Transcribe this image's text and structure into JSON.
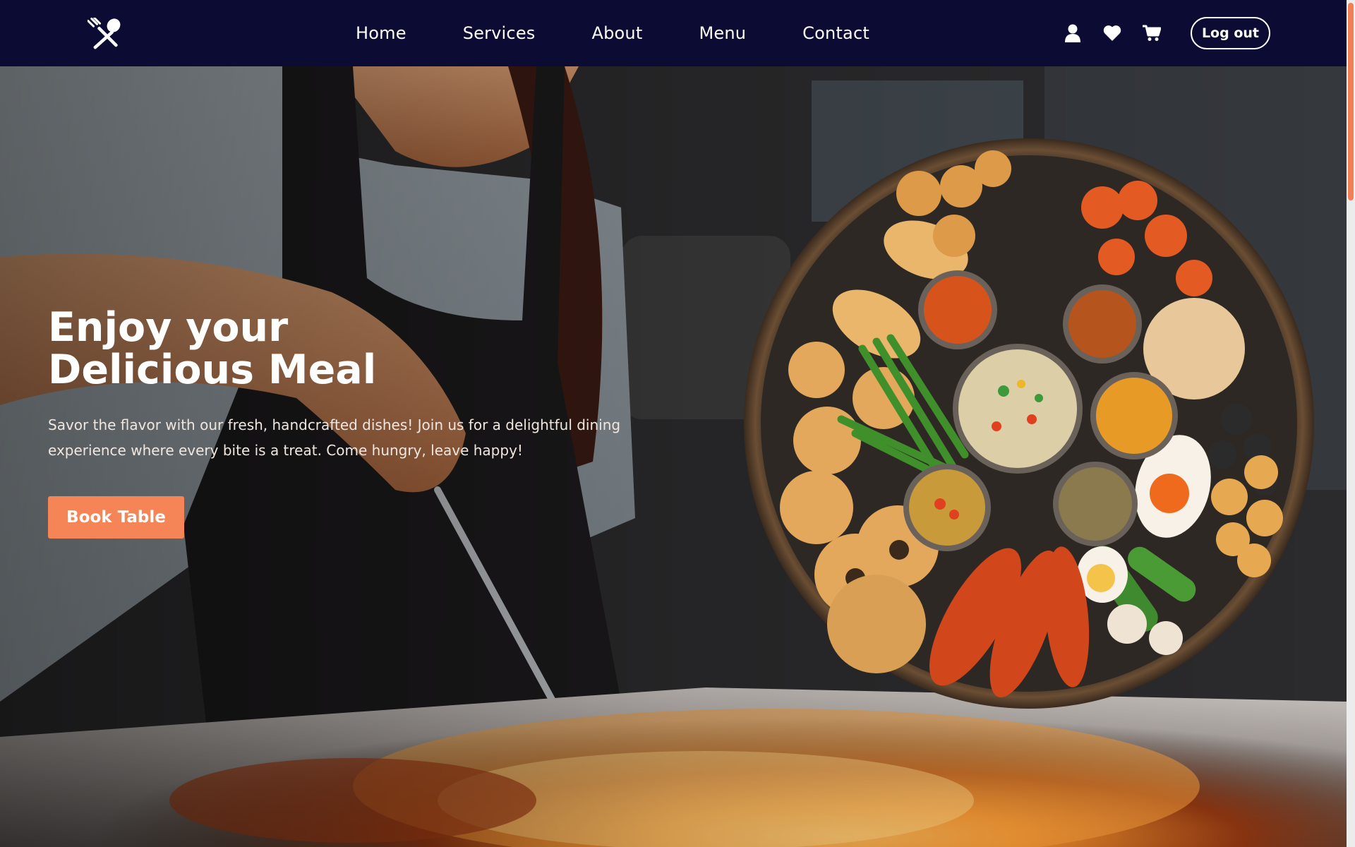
{
  "nav": {
    "links": [
      "Home",
      "Services",
      "About",
      "Menu",
      "Contact"
    ],
    "logout_label": "Log out",
    "icons": [
      "user-icon",
      "heart-icon",
      "cart-icon"
    ]
  },
  "hero": {
    "title_line1": "Enjoy your",
    "title_line2": "Delicious Meal",
    "description": "Savor the flavor with our fresh, handcrafted dishes! Join us for a delightful dining experience where every bite is a treat. Come hungry, leave happy!",
    "cta_label": "Book Table"
  },
  "colors": {
    "nav_bg": "#0b0b33",
    "accent": "#f58556",
    "text": "#ffffff"
  }
}
